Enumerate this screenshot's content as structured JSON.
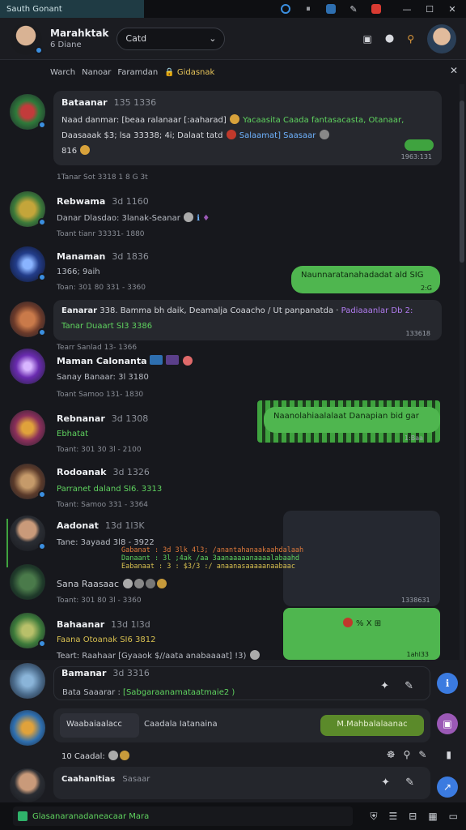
{
  "titlebar": {
    "app_name": "Sauth Gonant",
    "icons": [
      "circle-o-icon",
      "pause-icon",
      "app-icon",
      "tool-icon",
      "record-icon"
    ],
    "controls": [
      "minimize-icon",
      "maximize-icon",
      "close-icon"
    ]
  },
  "header": {
    "name": "Marahktak",
    "subtitle": "6 Diane",
    "select_value": "Catd",
    "actions": [
      "image-icon",
      "bell-icon",
      "pin-icon"
    ]
  },
  "subnav": {
    "items": [
      "Warch",
      "Nanoar",
      "Faramdan"
    ],
    "highlight": "Gidasnak"
  },
  "colors": {
    "accent_green": "#4fb64f",
    "text_green": "#5fd35f",
    "blue": "#3b8fe0",
    "purple": "#9b59b6"
  },
  "messages": [
    {
      "name": "Bataanar",
      "time": "135 1336",
      "bubble_line1": "Naad danmar: [beaa ralanaar [:aaharad]",
      "bubble_line1_green": "Yacaasita Caada fantasacasta, Otanaar,",
      "bubble_line2": "Daasaaak $3; lsa 33338; 4i; Dalaat tatd",
      "bubble_line2_blue": "Salaamat] Saasaar",
      "bubble_line3": "816",
      "bubble_time": "1963:131",
      "meta": "1Tanar Sot 3318 1 8 G 3t"
    },
    {
      "name": "Rebwama",
      "time": "3d 1160",
      "line": "Danar Dlasdao: 3lanak-Seanar",
      "meta": "Toant tianr 33331- 1880"
    },
    {
      "name": "Manaman",
      "time": "3d 1836",
      "line": "1366; 9aih",
      "meta": "Toan: 301 80 331 - 3360",
      "bubble_right": "Naunnaratanahadadat ald SIG",
      "bubble_right_time": "2:G"
    },
    {
      "name": "Eanarar",
      "time": "338. Bamma bh daik,",
      "line_white": "Deamalja Coaacho / Ut panpanatda ·",
      "line_purple": "Padiaaanlar Db 2:",
      "line_green": "Tanar Duaart SI3 3386",
      "bubble_time": "133618",
      "meta": "Tearr Sanlad 13- 1366"
    },
    {
      "name": "Maman Calonanta",
      "line": "Sanay Banaar: 3l 3180",
      "meta": "Toant Samoo 131- 1830"
    },
    {
      "name": "Rebnanar",
      "time": "3d 1308",
      "line_green": "Ebhatat",
      "meta": "Toant: 301 30 3l - 2100",
      "bubble_right": "Naanolahiaalalaat Danapian bid  gar",
      "bubble_right_time": "1:Baa"
    },
    {
      "name": "Rodoanak",
      "time": "3d 1326",
      "line_green": "Parranet daland SI6. 3313",
      "meta": "Toant: Samoo 331 - 3364"
    },
    {
      "name": "Aadonat",
      "time": "13d 1l3K",
      "line": "Tane: 3ayaad 3l8 - 3922",
      "code_lines": [
        "Gabanat : 3d 3lk 4l3; /anantahanaakaahdalaah",
        "Danaant : 3l ;4ak /aa 3aanaaaaanaaaalabaahd",
        "Eabanaat : 3 : $3/3 :/ anaanasaaaaanaabaac"
      ],
      "bubble_time": "1338631"
    },
    {
      "name": "Sana Raasaac",
      "meta": "Toant: 301 80 3l - 3360"
    },
    {
      "name": "Bahaanar",
      "time": "13d 1l3d",
      "line_yellow": "Faana Otoanak SI6 3812",
      "line2": "Teart: Raahaar [Gyaaok $//aata anabaaaat] !3)",
      "bubble_right": "% X",
      "bubble_right_time": "1ahl33"
    }
  ],
  "composer1": {
    "name": "Bamanar",
    "time": "3d 3316",
    "text": "Bata Saaarar :",
    "text_green": "[Sabgaraanamataatmaie2 )"
  },
  "composer2": {
    "left_text": "Waabaiaalacc",
    "mid_text": "Caadala Iatanaina",
    "button_label": "M.Mahbalalaanac"
  },
  "composer2_caption": "10 Caadal:",
  "composer3": {
    "name": "Caahanitias",
    "sub": "Sasaar"
  },
  "bottombar": {
    "input_text": "Glasanaranadaneacaar Mara",
    "icons": [
      "shield-icon",
      "list-icon",
      "number-icon",
      "calendar-icon",
      "chat-icon"
    ]
  }
}
